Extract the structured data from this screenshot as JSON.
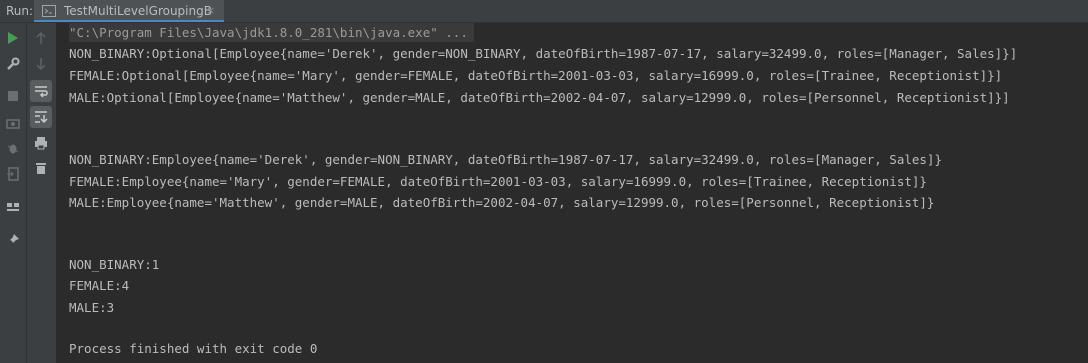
{
  "run_label": "Run:",
  "tab": {
    "label": "TestMultiLevelGroupingB",
    "close": "×"
  },
  "colors": {
    "play": "#499c54",
    "accent": "#4a88c7"
  },
  "toolbar_left": [
    {
      "name": "run-icon"
    },
    {
      "name": "wrench-icon"
    },
    {
      "name": "stop-icon"
    },
    {
      "name": "camera-icon"
    },
    {
      "name": "bug-icon"
    },
    {
      "name": "exit-icon"
    },
    {
      "name": "layout-icon"
    },
    {
      "name": "pin-icon"
    }
  ],
  "toolbar_right": [
    {
      "name": "up-arrow-icon"
    },
    {
      "name": "down-arrow-icon"
    },
    {
      "name": "soft-wrap-icon"
    },
    {
      "name": "scroll-to-end-icon"
    },
    {
      "name": "print-icon"
    },
    {
      "name": "trash-icon"
    }
  ],
  "console": {
    "command": "\"C:\\Program Files\\Java\\jdk1.8.0_281\\bin\\java.exe\" ...",
    "lines": [
      "NON_BINARY:Optional[Employee{name='Derek', gender=NON_BINARY, dateOfBirth=1987-07-17, salary=32499.0, roles=[Manager, Sales]}]",
      "FEMALE:Optional[Employee{name='Mary', gender=FEMALE, dateOfBirth=2001-03-03, salary=16999.0, roles=[Trainee, Receptionist]}]",
      "MALE:Optional[Employee{name='Matthew', gender=MALE, dateOfBirth=2002-04-07, salary=12999.0, roles=[Personnel, Receptionist]}]",
      "",
      "",
      "NON_BINARY:Employee{name='Derek', gender=NON_BINARY, dateOfBirth=1987-07-17, salary=32499.0, roles=[Manager, Sales]}",
      "FEMALE:Employee{name='Mary', gender=FEMALE, dateOfBirth=2001-03-03, salary=16999.0, roles=[Trainee, Receptionist]}",
      "MALE:Employee{name='Matthew', gender=MALE, dateOfBirth=2002-04-07, salary=12999.0, roles=[Personnel, Receptionist]}",
      "",
      "",
      "NON_BINARY:1",
      "FEMALE:4",
      "MALE:3",
      "",
      "Process finished with exit code 0"
    ]
  }
}
